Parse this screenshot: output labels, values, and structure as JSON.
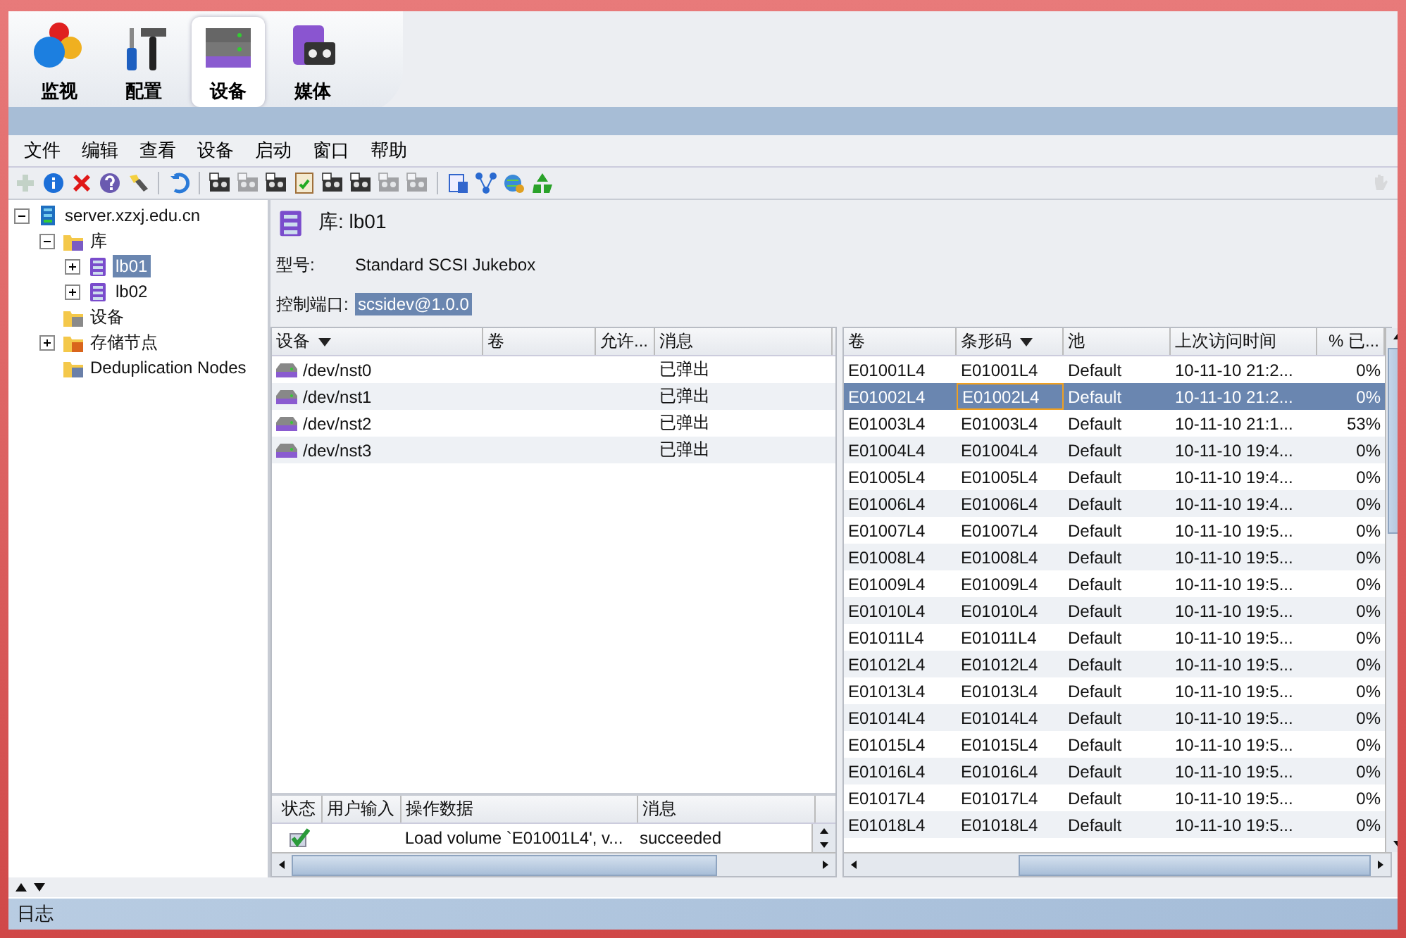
{
  "nav_tabs": [
    {
      "label": "监视",
      "kind": "monitor",
      "selected": false
    },
    {
      "label": "配置",
      "kind": "tools",
      "selected": false
    },
    {
      "label": "设备",
      "kind": "devices",
      "selected": true
    },
    {
      "label": "媒体",
      "kind": "media",
      "selected": false
    }
  ],
  "menu": [
    "文件",
    "编辑",
    "查看",
    "设备",
    "启动",
    "窗口",
    "帮助"
  ],
  "toolbar": [
    {
      "kind": "add",
      "disabled": true
    },
    {
      "kind": "info",
      "disabled": false
    },
    {
      "kind": "delete",
      "disabled": false
    },
    {
      "kind": "help",
      "disabled": false
    },
    {
      "kind": "torch",
      "disabled": false
    },
    {
      "kind": "sep"
    },
    {
      "kind": "undo",
      "disabled": false
    },
    {
      "kind": "sep"
    },
    {
      "kind": "tape",
      "disabled": false
    },
    {
      "kind": "tape",
      "disabled": true
    },
    {
      "kind": "tape",
      "disabled": false
    },
    {
      "kind": "checklist",
      "disabled": false
    },
    {
      "kind": "tape",
      "disabled": false
    },
    {
      "kind": "tape",
      "disabled": false
    },
    {
      "kind": "tape",
      "disabled": true
    },
    {
      "kind": "tape",
      "disabled": true
    },
    {
      "kind": "sep"
    },
    {
      "kind": "report",
      "disabled": false
    },
    {
      "kind": "network",
      "disabled": false
    },
    {
      "kind": "globe",
      "disabled": false
    },
    {
      "kind": "recycle",
      "disabled": false
    }
  ],
  "tree": [
    {
      "label": "server.xzxj.edu.cn",
      "kind": "server",
      "expanded": true,
      "selected": false,
      "children": [
        {
          "label": "库",
          "kind": "library-folder",
          "expanded": true,
          "selected": false,
          "children": [
            {
              "label": "lb01",
              "kind": "library",
              "expanded": false,
              "selected": true
            },
            {
              "label": "lb02",
              "kind": "library",
              "expanded": false,
              "selected": false
            }
          ]
        },
        {
          "label": "设备",
          "kind": "device-folder",
          "selected": false
        },
        {
          "label": "存储节点",
          "kind": "node-folder",
          "expanded": false,
          "selected": false
        },
        {
          "label": "Deduplication Nodes",
          "kind": "dedup-folder",
          "selected": false
        }
      ]
    }
  ],
  "detail": {
    "title": "库: lb01",
    "fields": [
      {
        "label": "型号:",
        "value": "Standard SCSI Jukebox",
        "selected": false
      },
      {
        "label": "控制端口:",
        "value": "scsidev@1.0.0",
        "selected": true
      }
    ]
  },
  "devices": {
    "columns": [
      {
        "label": "设备",
        "sorted": true
      },
      {
        "label": "卷",
        "sorted": false
      },
      {
        "label": "允许...",
        "sorted": false
      },
      {
        "label": "消息",
        "sorted": false
      }
    ],
    "rows": [
      {
        "device": "/dev/nst0",
        "message": "已弹出"
      },
      {
        "device": "/dev/nst1",
        "message": "已弹出"
      },
      {
        "device": "/dev/nst2",
        "message": "已弹出"
      },
      {
        "device": "/dev/nst3",
        "message": "已弹出"
      }
    ]
  },
  "operations": {
    "columns": [
      "状态",
      "用户输入",
      "操作数据",
      "消息"
    ],
    "rows": [
      {
        "succeeded": true,
        "data": "Load volume `E01001L4', v...",
        "message": "succeeded"
      }
    ]
  },
  "volumes": {
    "columns": [
      {
        "label": "卷",
        "sorted": false
      },
      {
        "label": "条形码",
        "sorted": true
      },
      {
        "label": "池",
        "sorted": false
      },
      {
        "label": "上次访问时间",
        "sorted": false
      },
      {
        "label": "% 已...",
        "sorted": false
      }
    ],
    "rows": [
      {
        "volume": "E01001L4",
        "barcode": "E01001L4",
        "pool": "Default",
        "last_access": "10-11-10 21:2...",
        "percent": "0%",
        "selected": false
      },
      {
        "volume": "E01002L4",
        "barcode": "E01002L4",
        "pool": "Default",
        "last_access": "10-11-10 21:2...",
        "percent": "0%",
        "selected": true
      },
      {
        "volume": "E01003L4",
        "barcode": "E01003L4",
        "pool": "Default",
        "last_access": "10-11-10 21:1...",
        "percent": "53%",
        "selected": false
      },
      {
        "volume": "E01004L4",
        "barcode": "E01004L4",
        "pool": "Default",
        "last_access": "10-11-10 19:4...",
        "percent": "0%",
        "selected": false
      },
      {
        "volume": "E01005L4",
        "barcode": "E01005L4",
        "pool": "Default",
        "last_access": "10-11-10 19:4...",
        "percent": "0%",
        "selected": false
      },
      {
        "volume": "E01006L4",
        "barcode": "E01006L4",
        "pool": "Default",
        "last_access": "10-11-10 19:4...",
        "percent": "0%",
        "selected": false
      },
      {
        "volume": "E01007L4",
        "barcode": "E01007L4",
        "pool": "Default",
        "last_access": "10-11-10 19:5...",
        "percent": "0%",
        "selected": false
      },
      {
        "volume": "E01008L4",
        "barcode": "E01008L4",
        "pool": "Default",
        "last_access": "10-11-10 19:5...",
        "percent": "0%",
        "selected": false
      },
      {
        "volume": "E01009L4",
        "barcode": "E01009L4",
        "pool": "Default",
        "last_access": "10-11-10 19:5...",
        "percent": "0%",
        "selected": false
      },
      {
        "volume": "E01010L4",
        "barcode": "E01010L4",
        "pool": "Default",
        "last_access": "10-11-10 19:5...",
        "percent": "0%",
        "selected": false
      },
      {
        "volume": "E01011L4",
        "barcode": "E01011L4",
        "pool": "Default",
        "last_access": "10-11-10 19:5...",
        "percent": "0%",
        "selected": false
      },
      {
        "volume": "E01012L4",
        "barcode": "E01012L4",
        "pool": "Default",
        "last_access": "10-11-10 19:5...",
        "percent": "0%",
        "selected": false
      },
      {
        "volume": "E01013L4",
        "barcode": "E01013L4",
        "pool": "Default",
        "last_access": "10-11-10 19:5...",
        "percent": "0%",
        "selected": false
      },
      {
        "volume": "E01014L4",
        "barcode": "E01014L4",
        "pool": "Default",
        "last_access": "10-11-10 19:5...",
        "percent": "0%",
        "selected": false
      },
      {
        "volume": "E01015L4",
        "barcode": "E01015L4",
        "pool": "Default",
        "last_access": "10-11-10 19:5...",
        "percent": "0%",
        "selected": false
      },
      {
        "volume": "E01016L4",
        "barcode": "E01016L4",
        "pool": "Default",
        "last_access": "10-11-10 19:5...",
        "percent": "0%",
        "selected": false
      },
      {
        "volume": "E01017L4",
        "barcode": "E01017L4",
        "pool": "Default",
        "last_access": "10-11-10 19:5...",
        "percent": "0%",
        "selected": false
      },
      {
        "volume": "E01018L4",
        "barcode": "E01018L4",
        "pool": "Default",
        "last_access": "10-11-10 19:5...",
        "percent": "0%",
        "selected": false
      }
    ]
  },
  "log": {
    "title": "日志"
  }
}
